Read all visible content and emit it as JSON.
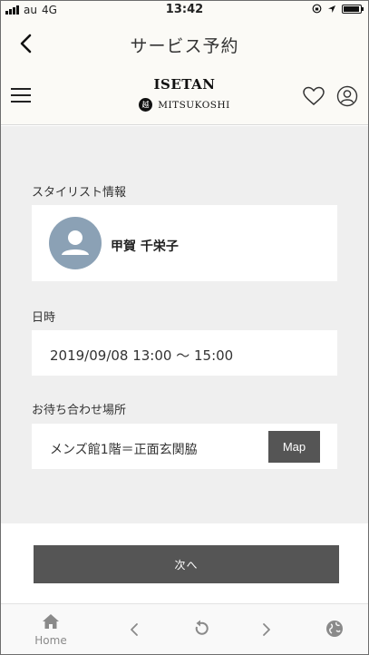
{
  "status_bar": {
    "carrier": "au",
    "network": "4G",
    "time": "13:42"
  },
  "nav": {
    "title": "サービス予約"
  },
  "site_header": {
    "logo_primary": "ISETAN",
    "logo_secondary": "MITSUKOSHI"
  },
  "stylist": {
    "section_label": "スタイリスト情報",
    "name": "甲賀 千栄子"
  },
  "datetime": {
    "section_label": "日時",
    "value": "2019/09/08 13:00 〜 15:00"
  },
  "meeting": {
    "section_label": "お待ち合わせ場所",
    "place": "メンズ館1階＝正面玄関脇",
    "map_label": "Map"
  },
  "next_label": "次へ",
  "toolbar": {
    "home_label": "Home"
  },
  "colors": {
    "button_bg": "#555555",
    "avatar_bg": "#8ba1b5",
    "page_bg": "#efefef",
    "header_bg": "#fbfaf6"
  }
}
